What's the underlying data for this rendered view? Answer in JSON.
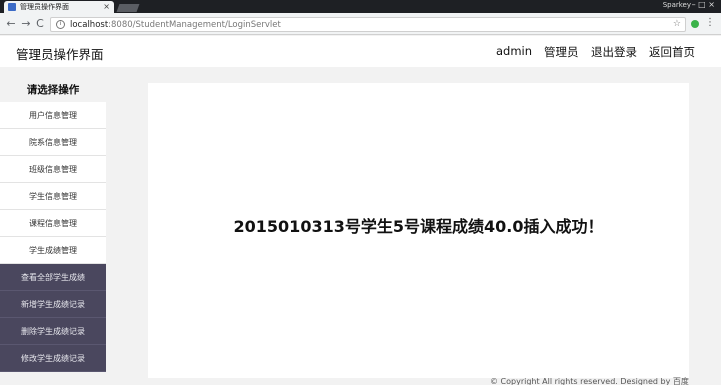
{
  "browser": {
    "tab_title": "管理员操作界面",
    "tab_close": "×",
    "profile_name": "Sparkey",
    "window_controls": "–  □  ×",
    "nav": {
      "back": "←",
      "forward": "→",
      "reload": "C"
    },
    "url_host": "localhost",
    "url_rest": ":8080/StudentManagement/LoginServlet",
    "info_glyph": "i",
    "star_glyph": "☆",
    "menu_glyph": "⋮"
  },
  "header": {
    "title": "管理员操作界面",
    "nav": [
      "admin",
      "管理员",
      "退出登录",
      "返回首页"
    ]
  },
  "sidebar": {
    "heading": "请选择操作",
    "items": [
      "用户信息管理",
      "院系信息管理",
      "班级信息管理",
      "学生信息管理",
      "课程信息管理",
      "学生成绩管理"
    ],
    "subitems": [
      "查看全部学生成绩",
      "新增学生成绩记录",
      "删除学生成绩记录",
      "修改学生成绩记录"
    ]
  },
  "content": {
    "message": "2015010313号学生5号课程成绩40.0插入成功！"
  },
  "footer": {
    "text": "© Copyright All rights reserved. Designed by 百度"
  }
}
